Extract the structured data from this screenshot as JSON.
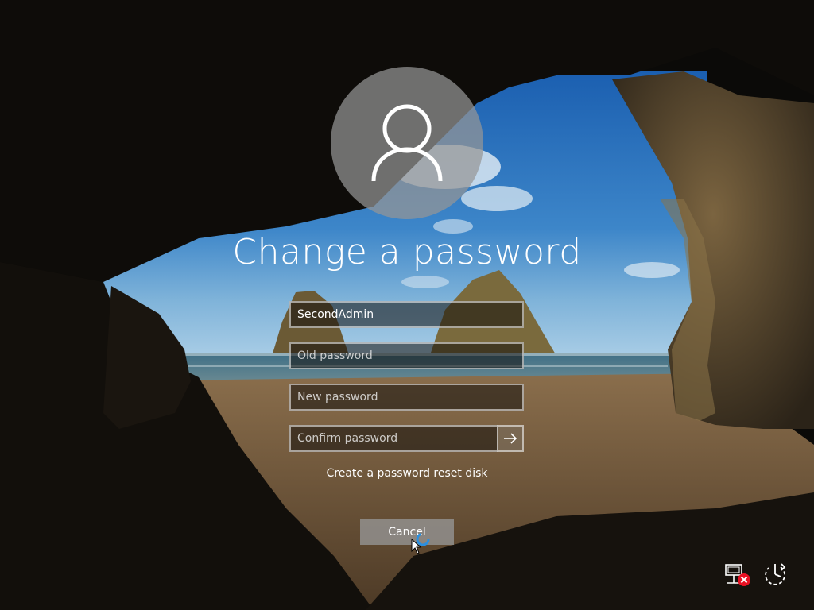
{
  "screen": {
    "title": "Change a password"
  },
  "form": {
    "username_value": "SecondAdmin",
    "old_password_placeholder": "Old password",
    "new_password_placeholder": "New password",
    "confirm_password_placeholder": "Confirm password"
  },
  "links": {
    "reset_disk": "Create a password reset disk"
  },
  "buttons": {
    "cancel_label": "Cancel"
  },
  "icons": {
    "avatar": "user-icon",
    "submit": "arrow-right-icon",
    "network": "network-disconnected-icon",
    "power": "power-icon"
  },
  "colors": {
    "text": "#ffffff",
    "error_badge": "#e81123",
    "avatar_bg": "#969696"
  }
}
